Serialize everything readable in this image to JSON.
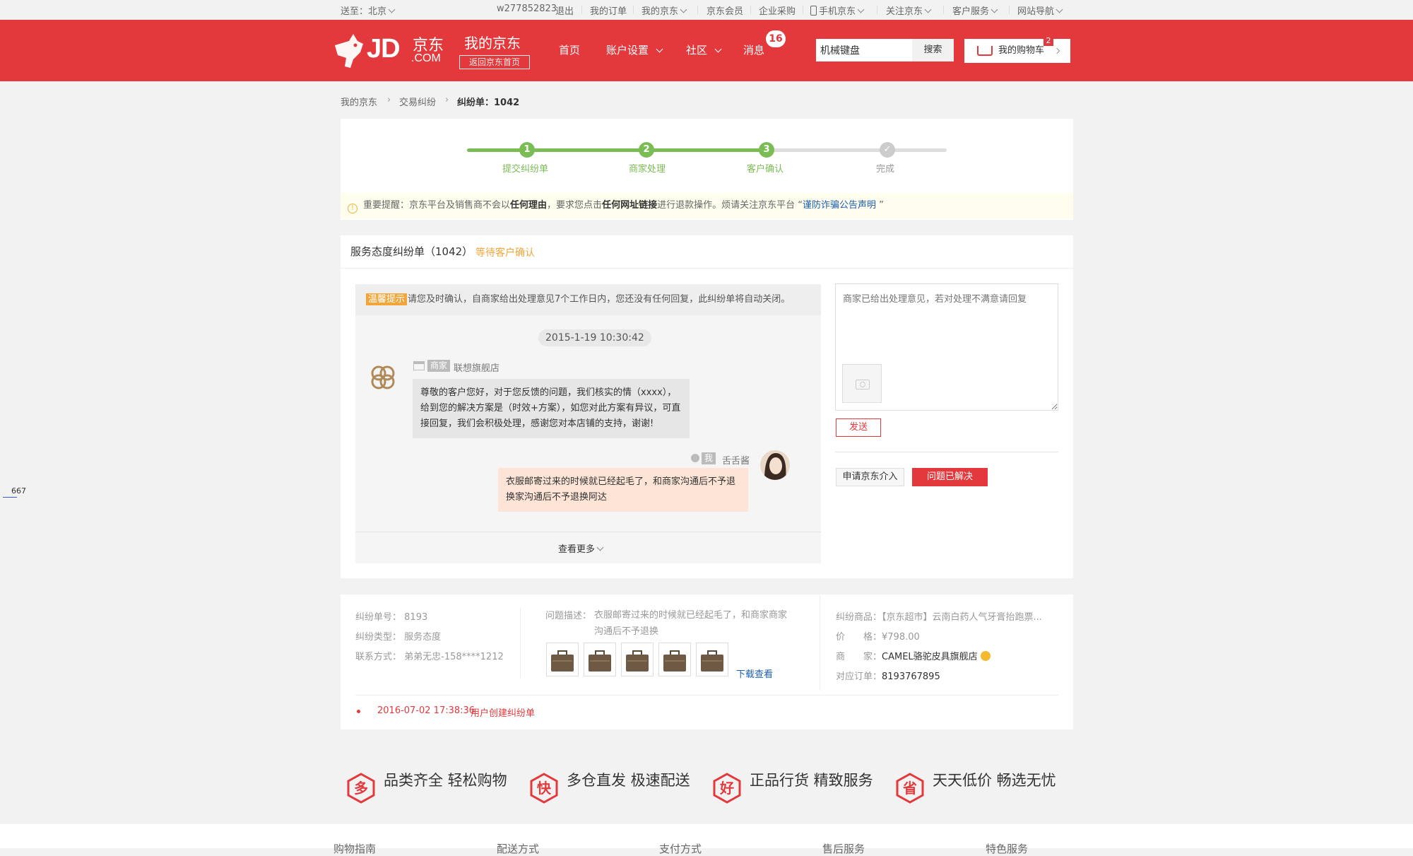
{
  "topbar": {
    "deliver_to": "送至：北京",
    "username": "w277852823",
    "logout": "退出",
    "links": [
      "我的订单",
      "我的京东",
      "京东会员",
      "企业采购",
      "手机京东",
      "关注京东",
      "客户服务",
      "网站导航"
    ]
  },
  "header": {
    "logo_text": "JD.COM",
    "logo_cn": "京东",
    "title": "我的京东",
    "back_home": "返回京东首页",
    "nav": [
      "首页",
      "账户设置",
      "社区",
      "消息"
    ],
    "message_count": "16",
    "search_value": "机械键盘",
    "search_button": "搜索",
    "cart_label": "我的购物车",
    "cart_count": "2"
  },
  "breadcrumb": {
    "items": [
      "我的京东",
      "交易纠纷",
      "纠纷单：1042"
    ]
  },
  "progress": {
    "steps": [
      {
        "num": "1",
        "label": "提交纠纷单",
        "done": true
      },
      {
        "num": "2",
        "label": "商家处理",
        "done": true
      },
      {
        "num": "3",
        "label": "客户确认",
        "done": true
      },
      {
        "num": "✓",
        "label": "完成",
        "done": false
      }
    ]
  },
  "notice": {
    "prefix": "重要提醒：",
    "part1": "京东平台及销售商不会以",
    "bold1": "任何理由",
    "part2": "，要求您点击",
    "bold2": "任何网址链接",
    "part3": "进行退款操作。烦请关注京东平台 “",
    "link": "谨防诈骗公告声明",
    "suffix": " ”"
  },
  "dispute": {
    "title": "服务态度纠纷单（1042）",
    "status": "等待客户确认",
    "tip_label": "温馨提示",
    "tip_text": "请您及时确认，自商家给出处理意见7个工作日内，您还没有任何回复，此纠纷单将自动关闭。",
    "timestamp": "2015-1-19 10:30:42",
    "merchant_tag": "商家",
    "merchant_name": "联想旗舰店",
    "merchant_msg": "尊敬的客户您好，对于您反馈的问题，我们核实的情（xxxx），给到您的解决方案是（时效+方案），如您对此方案有异议，可直接回复，我们会积极处理，感谢您对本店铺的支持，谢谢!",
    "user_tag": "我",
    "user_name": "舌舌酱",
    "user_msg": "衣服邮寄过来的时候就已经起毛了，和商家沟通后不予退换家沟通后不予退换阿达",
    "view_more": "查看更多",
    "reply_placeholder": "商家已给出处理意见，若对处理不满意请回复",
    "send_button": "发送",
    "request_jd": "申请京东介入",
    "resolved": "问题已解决"
  },
  "order_info": {
    "dispute_no_label": "纠纷单号：",
    "dispute_no": "8193",
    "type_label": "纠纷类型：",
    "type": "服务态度",
    "contact_label": "联系方式：",
    "contact": "弟弟无忠-158****1212",
    "desc_label": "问题描述：",
    "desc": "衣服邮寄过来的时候就已经起毛了，和商家商家沟通后不予退换",
    "download": "下载查看",
    "product_label": "纠纷商品：",
    "product": "【京东超市】云南白药人气牙膏抬跑票...",
    "price_label": "价　　格：",
    "price": "¥798.00",
    "shop_label": "商　　家：",
    "shop": "CAMEL骆驼皮具旗舰店",
    "order_label": "对应订单：",
    "order": "8193767895",
    "log_time": "2016-07-02 17:38:36",
    "log_text": "用户创建纠纷单"
  },
  "features": [
    {
      "icon": "多",
      "text": "品类齐全  轻松购物"
    },
    {
      "icon": "快",
      "text": "多仓直发  极速配送"
    },
    {
      "icon": "好",
      "text": "正品行货  精致服务"
    },
    {
      "icon": "省",
      "text": "天天低价  畅选无忧"
    }
  ],
  "footer": {
    "columns": [
      "购物指南",
      "配送方式",
      "支付方式",
      "售后服务",
      "特色服务"
    ]
  },
  "side_marker": "667",
  "colors": {
    "brand": "#e4393c",
    "green": "#7abd54",
    "orange": "#f2a63a"
  }
}
